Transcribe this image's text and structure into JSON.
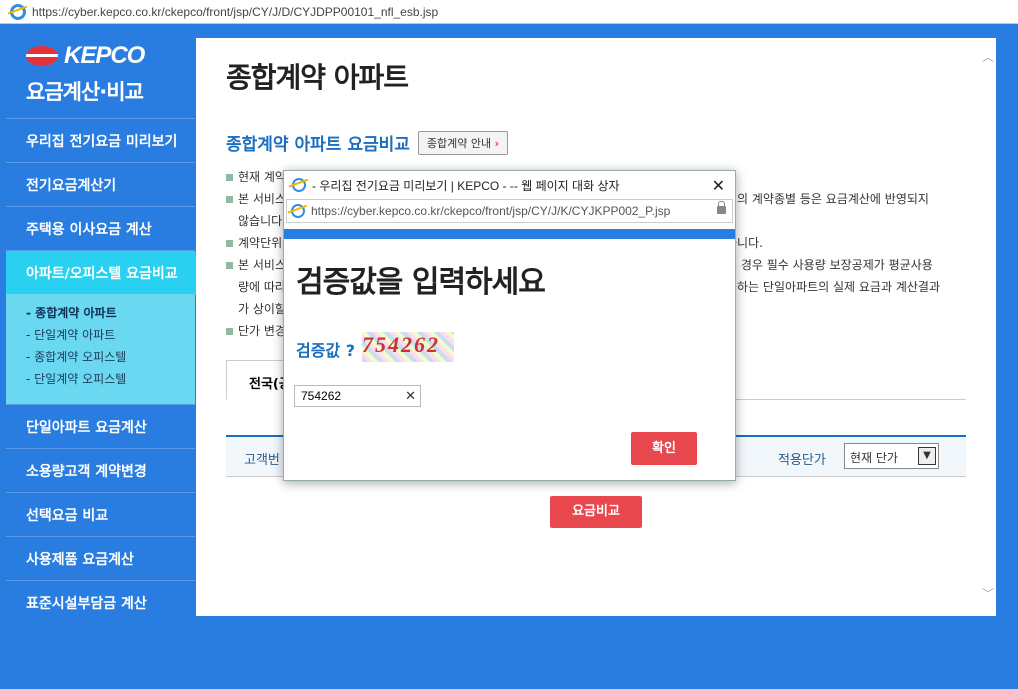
{
  "browser": {
    "url": "https://cyber.kepco.co.kr/ckepco/front/jsp/CY/J/D/CYJDPP00101_nfl_esb.jsp"
  },
  "logo": {
    "brand": "KEPCO",
    "subtitle": "요금계산·비교"
  },
  "sidebar": {
    "items": [
      {
        "label": "우리집 전기요금 미리보기"
      },
      {
        "label": "전기요금계산기"
      },
      {
        "label": "주택용 이사요금 계산"
      },
      {
        "label": "아파트/오피스텔 요금비교"
      },
      {
        "label": "단일아파트 요금계산"
      },
      {
        "label": "소용량고객 계약변경"
      },
      {
        "label": "선택요금 비교"
      },
      {
        "label": "사용제품 요금계산"
      },
      {
        "label": "표준시설부담금 계산"
      }
    ],
    "submenu": [
      "- 종합계약 아파트",
      "- 단일계약 아파트",
      "- 종합계약 오피스텔",
      "- 단일계약 오피스텔"
    ]
  },
  "main": {
    "title": "종합계약 아파트",
    "section_title": "종합계약 아파트 요금비교",
    "guide_button": "종합계약 안내",
    "notes": [
      "현재 계약",
      "본 서비스",
      "않습니다",
      "계약단위",
      "본 서비스",
      "량에 따라",
      "가 상이할",
      "단가 변경"
    ],
    "notes_right": [
      "외의 계약종별 등은 요금계산에 반영되지",
      "",
      "습니다.",
      "의 경우 필수 사용량 보장공제가 평균사용",
      "출하는 단일아파트의 실제 요금과 계산결과",
      ""
    ],
    "tab_label": "전국(공",
    "form": {
      "label_customer": "고객번",
      "label_rate": "적용단가",
      "rate_value": "현재 단가"
    },
    "compare_button": "요금비교"
  },
  "dialog": {
    "title": "- 우리집 전기요금 미리보기 | KEPCO - -- 웹 페이지 대화 상자",
    "url": "https://cyber.kepco.co.kr/ckepco/front/jsp/CY/J/K/CYJKPP002_P.jsp",
    "heading": "검증값을 입력하세요",
    "question": "검증값 ?",
    "captcha_text": "754262",
    "input_value": "754262",
    "confirm_button": "확인"
  }
}
